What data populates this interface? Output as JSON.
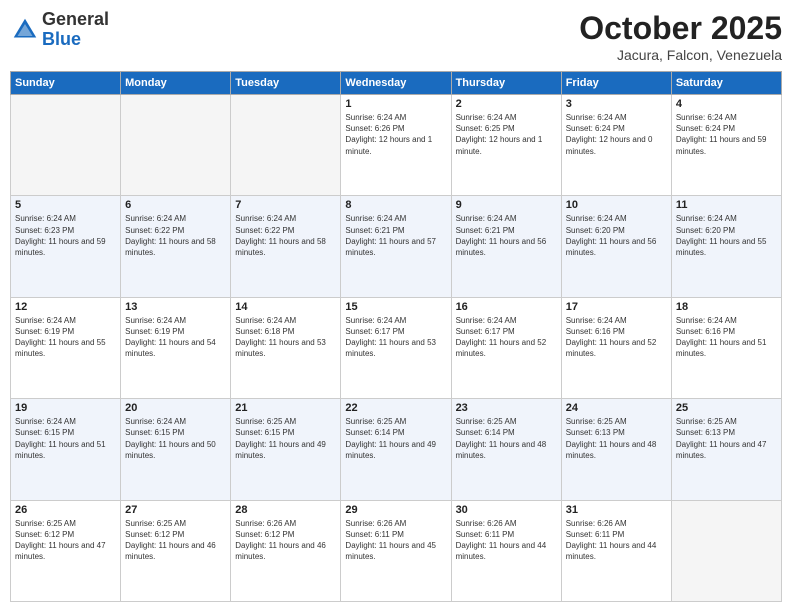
{
  "logo": {
    "general": "General",
    "blue": "Blue"
  },
  "header": {
    "month": "October 2025",
    "location": "Jacura, Falcon, Venezuela"
  },
  "days_of_week": [
    "Sunday",
    "Monday",
    "Tuesday",
    "Wednesday",
    "Thursday",
    "Friday",
    "Saturday"
  ],
  "weeks": [
    [
      {
        "day": "",
        "sunrise": "",
        "sunset": "",
        "daylight": ""
      },
      {
        "day": "",
        "sunrise": "",
        "sunset": "",
        "daylight": ""
      },
      {
        "day": "",
        "sunrise": "",
        "sunset": "",
        "daylight": ""
      },
      {
        "day": "1",
        "sunrise": "Sunrise: 6:24 AM",
        "sunset": "Sunset: 6:26 PM",
        "daylight": "Daylight: 12 hours and 1 minute."
      },
      {
        "day": "2",
        "sunrise": "Sunrise: 6:24 AM",
        "sunset": "Sunset: 6:25 PM",
        "daylight": "Daylight: 12 hours and 1 minute."
      },
      {
        "day": "3",
        "sunrise": "Sunrise: 6:24 AM",
        "sunset": "Sunset: 6:24 PM",
        "daylight": "Daylight: 12 hours and 0 minutes."
      },
      {
        "day": "4",
        "sunrise": "Sunrise: 6:24 AM",
        "sunset": "Sunset: 6:24 PM",
        "daylight": "Daylight: 11 hours and 59 minutes."
      }
    ],
    [
      {
        "day": "5",
        "sunrise": "Sunrise: 6:24 AM",
        "sunset": "Sunset: 6:23 PM",
        "daylight": "Daylight: 11 hours and 59 minutes."
      },
      {
        "day": "6",
        "sunrise": "Sunrise: 6:24 AM",
        "sunset": "Sunset: 6:22 PM",
        "daylight": "Daylight: 11 hours and 58 minutes."
      },
      {
        "day": "7",
        "sunrise": "Sunrise: 6:24 AM",
        "sunset": "Sunset: 6:22 PM",
        "daylight": "Daylight: 11 hours and 58 minutes."
      },
      {
        "day": "8",
        "sunrise": "Sunrise: 6:24 AM",
        "sunset": "Sunset: 6:21 PM",
        "daylight": "Daylight: 11 hours and 57 minutes."
      },
      {
        "day": "9",
        "sunrise": "Sunrise: 6:24 AM",
        "sunset": "Sunset: 6:21 PM",
        "daylight": "Daylight: 11 hours and 56 minutes."
      },
      {
        "day": "10",
        "sunrise": "Sunrise: 6:24 AM",
        "sunset": "Sunset: 6:20 PM",
        "daylight": "Daylight: 11 hours and 56 minutes."
      },
      {
        "day": "11",
        "sunrise": "Sunrise: 6:24 AM",
        "sunset": "Sunset: 6:20 PM",
        "daylight": "Daylight: 11 hours and 55 minutes."
      }
    ],
    [
      {
        "day": "12",
        "sunrise": "Sunrise: 6:24 AM",
        "sunset": "Sunset: 6:19 PM",
        "daylight": "Daylight: 11 hours and 55 minutes."
      },
      {
        "day": "13",
        "sunrise": "Sunrise: 6:24 AM",
        "sunset": "Sunset: 6:19 PM",
        "daylight": "Daylight: 11 hours and 54 minutes."
      },
      {
        "day": "14",
        "sunrise": "Sunrise: 6:24 AM",
        "sunset": "Sunset: 6:18 PM",
        "daylight": "Daylight: 11 hours and 53 minutes."
      },
      {
        "day": "15",
        "sunrise": "Sunrise: 6:24 AM",
        "sunset": "Sunset: 6:17 PM",
        "daylight": "Daylight: 11 hours and 53 minutes."
      },
      {
        "day": "16",
        "sunrise": "Sunrise: 6:24 AM",
        "sunset": "Sunset: 6:17 PM",
        "daylight": "Daylight: 11 hours and 52 minutes."
      },
      {
        "day": "17",
        "sunrise": "Sunrise: 6:24 AM",
        "sunset": "Sunset: 6:16 PM",
        "daylight": "Daylight: 11 hours and 52 minutes."
      },
      {
        "day": "18",
        "sunrise": "Sunrise: 6:24 AM",
        "sunset": "Sunset: 6:16 PM",
        "daylight": "Daylight: 11 hours and 51 minutes."
      }
    ],
    [
      {
        "day": "19",
        "sunrise": "Sunrise: 6:24 AM",
        "sunset": "Sunset: 6:15 PM",
        "daylight": "Daylight: 11 hours and 51 minutes."
      },
      {
        "day": "20",
        "sunrise": "Sunrise: 6:24 AM",
        "sunset": "Sunset: 6:15 PM",
        "daylight": "Daylight: 11 hours and 50 minutes."
      },
      {
        "day": "21",
        "sunrise": "Sunrise: 6:25 AM",
        "sunset": "Sunset: 6:15 PM",
        "daylight": "Daylight: 11 hours and 49 minutes."
      },
      {
        "day": "22",
        "sunrise": "Sunrise: 6:25 AM",
        "sunset": "Sunset: 6:14 PM",
        "daylight": "Daylight: 11 hours and 49 minutes."
      },
      {
        "day": "23",
        "sunrise": "Sunrise: 6:25 AM",
        "sunset": "Sunset: 6:14 PM",
        "daylight": "Daylight: 11 hours and 48 minutes."
      },
      {
        "day": "24",
        "sunrise": "Sunrise: 6:25 AM",
        "sunset": "Sunset: 6:13 PM",
        "daylight": "Daylight: 11 hours and 48 minutes."
      },
      {
        "day": "25",
        "sunrise": "Sunrise: 6:25 AM",
        "sunset": "Sunset: 6:13 PM",
        "daylight": "Daylight: 11 hours and 47 minutes."
      }
    ],
    [
      {
        "day": "26",
        "sunrise": "Sunrise: 6:25 AM",
        "sunset": "Sunset: 6:12 PM",
        "daylight": "Daylight: 11 hours and 47 minutes."
      },
      {
        "day": "27",
        "sunrise": "Sunrise: 6:25 AM",
        "sunset": "Sunset: 6:12 PM",
        "daylight": "Daylight: 11 hours and 46 minutes."
      },
      {
        "day": "28",
        "sunrise": "Sunrise: 6:26 AM",
        "sunset": "Sunset: 6:12 PM",
        "daylight": "Daylight: 11 hours and 46 minutes."
      },
      {
        "day": "29",
        "sunrise": "Sunrise: 6:26 AM",
        "sunset": "Sunset: 6:11 PM",
        "daylight": "Daylight: 11 hours and 45 minutes."
      },
      {
        "day": "30",
        "sunrise": "Sunrise: 6:26 AM",
        "sunset": "Sunset: 6:11 PM",
        "daylight": "Daylight: 11 hours and 44 minutes."
      },
      {
        "day": "31",
        "sunrise": "Sunrise: 6:26 AM",
        "sunset": "Sunset: 6:11 PM",
        "daylight": "Daylight: 11 hours and 44 minutes."
      },
      {
        "day": "",
        "sunrise": "",
        "sunset": "",
        "daylight": ""
      }
    ]
  ]
}
